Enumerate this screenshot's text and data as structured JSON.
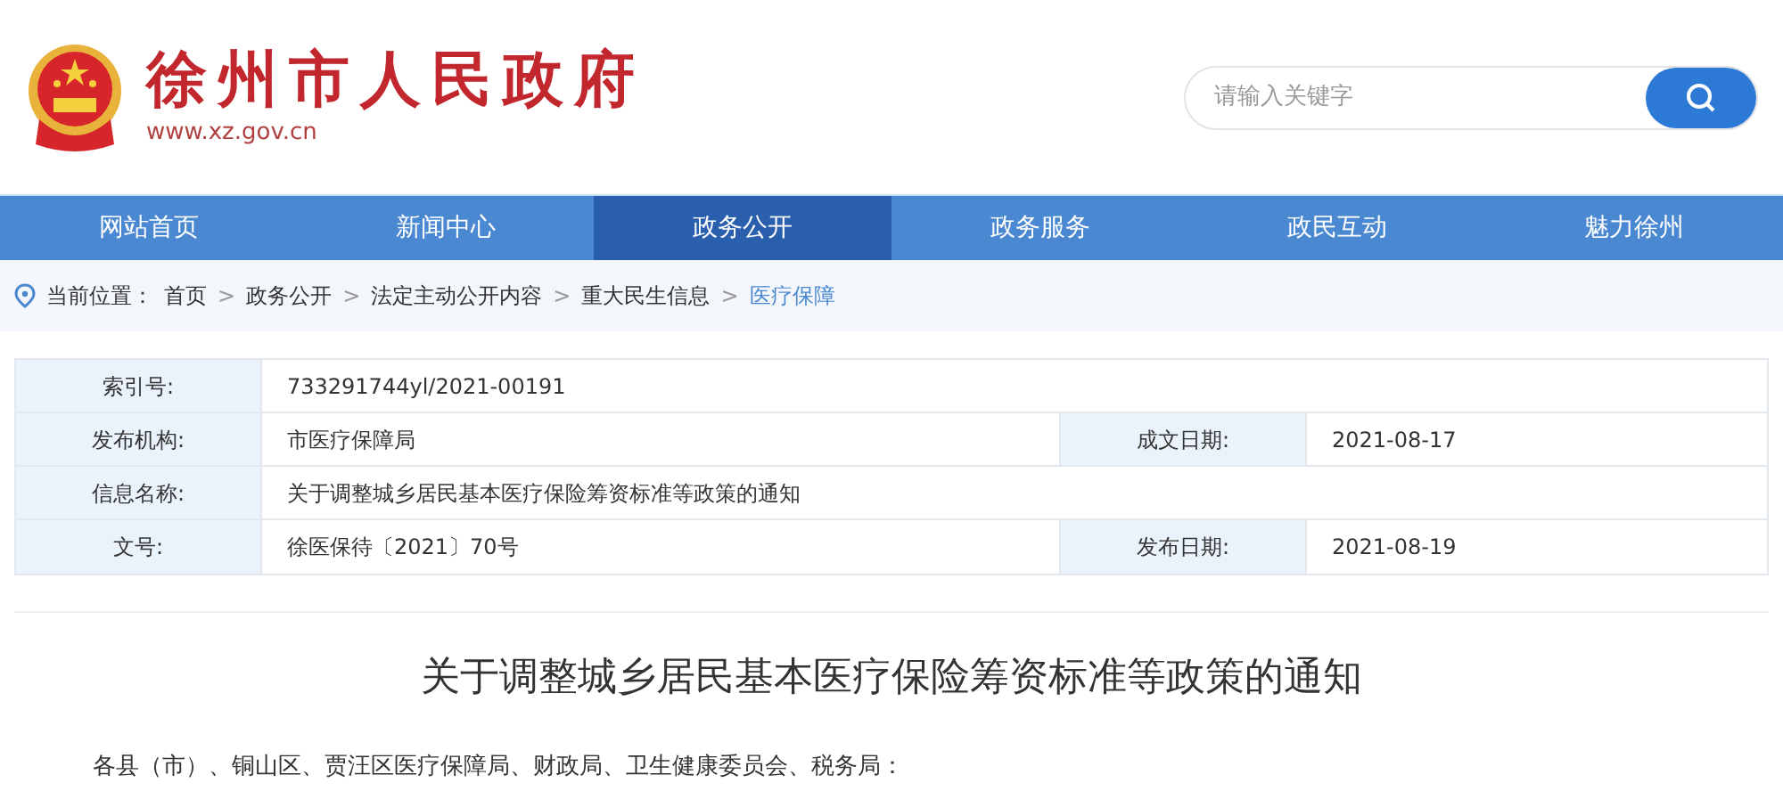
{
  "header": {
    "site_name": "徐州市人民政府",
    "url": "www.xz.gov.cn"
  },
  "search": {
    "placeholder": "请输入关键字"
  },
  "nav": [
    {
      "label": "网站首页",
      "selected": false
    },
    {
      "label": "新闻中心",
      "selected": false
    },
    {
      "label": "政务公开",
      "selected": true
    },
    {
      "label": "政务服务",
      "selected": false
    },
    {
      "label": "政民互动",
      "selected": false
    },
    {
      "label": "魅力徐州",
      "selected": false
    }
  ],
  "breadcrumb": {
    "label": "当前位置：",
    "items": [
      {
        "label": "首页",
        "current": false
      },
      {
        "label": "政务公开",
        "current": false
      },
      {
        "label": "法定主动公开内容",
        "current": false
      },
      {
        "label": "重大民生信息",
        "current": false
      },
      {
        "label": "医疗保障",
        "current": true
      }
    ],
    "separators": [
      ">",
      ">",
      ">",
      ">"
    ]
  },
  "info_table": [
    {
      "cells": [
        {
          "label": "索引号:",
          "value": "733291744yl/2021-00191"
        }
      ]
    },
    {
      "cells": [
        {
          "label": "发布机构:",
          "value": "市医疗保障局"
        },
        {
          "label": "成文日期:",
          "value": "2021-08-17"
        }
      ]
    },
    {
      "cells": [
        {
          "label": "信息名称:",
          "value": "关于调整城乡居民基本医疗保险筹资标准等政策的通知"
        }
      ]
    },
    {
      "cells": [
        {
          "label": "文号:",
          "value": "徐医保待〔2021〕70号"
        },
        {
          "label": "发布日期:",
          "value": "2021-08-19"
        }
      ]
    }
  ],
  "article": {
    "title": "关于调整城乡居民基本医疗保险筹资标准等政策的通知",
    "salutation": "各县（市）、铜山区、贾汪区医疗保障局、财政局、卫生健康委员会、税务局："
  }
}
